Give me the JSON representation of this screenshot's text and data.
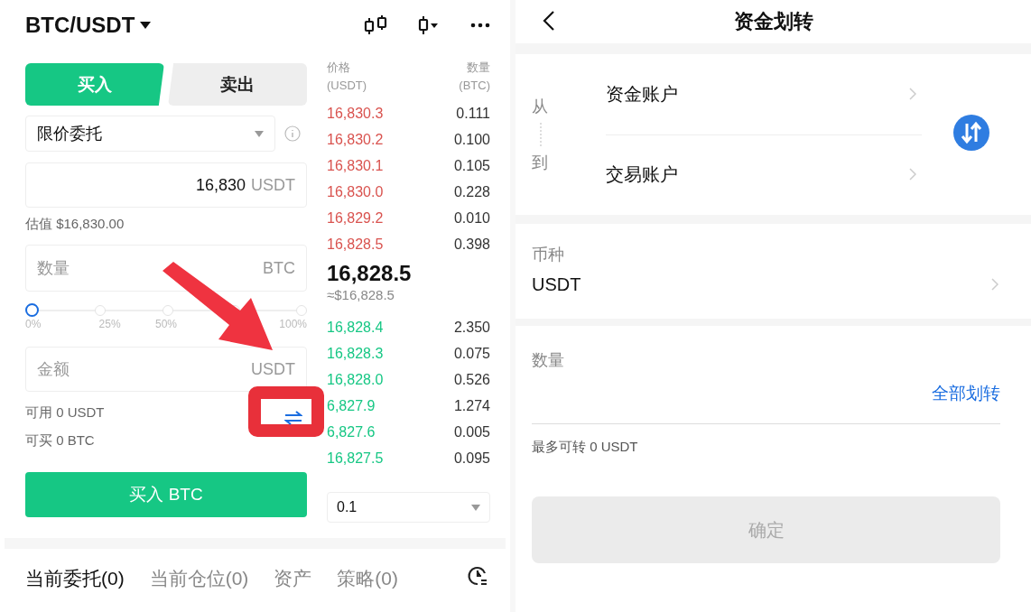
{
  "trade": {
    "pair": "BTC/USDT",
    "side_tabs": [
      {
        "label": "买入",
        "selected": true
      },
      {
        "label": "卖出",
        "selected": false
      }
    ],
    "order_type": "限价委托",
    "price_field": {
      "value": "16,830",
      "unit": "USDT"
    },
    "estimate": "估值 $16,830.00",
    "quantity_field": {
      "placeholder": "数量",
      "unit": "BTC"
    },
    "slider": {
      "level": 0,
      "tick_labels": [
        "0%",
        "25%",
        "50%",
        "100%"
      ]
    },
    "amount_field": {
      "placeholder": "金额",
      "unit": "USDT"
    },
    "available": "可用 0 USDT",
    "buyable": "可买 0 BTC",
    "buy_button": "买入 BTC"
  },
  "order_book": {
    "columns": [
      {
        "label": "价格",
        "unit": "(USDT)"
      },
      {
        "label": "数量",
        "unit": "(BTC)"
      }
    ],
    "asks": [
      {
        "price": "16,830.3",
        "amount": "0.111"
      },
      {
        "price": "16,830.2",
        "amount": "0.100"
      },
      {
        "price": "16,830.1",
        "amount": "0.105"
      },
      {
        "price": "16,830.0",
        "amount": "0.228"
      },
      {
        "price": "16,829.2",
        "amount": "0.010"
      },
      {
        "price": "16,828.5",
        "amount": "0.398"
      }
    ],
    "last_price": "16,828.5",
    "last_price_usd": "≈$16,828.5",
    "bids": [
      {
        "price": "16,828.4",
        "amount": "2.350"
      },
      {
        "price": "16,828.3",
        "amount": "0.075"
      },
      {
        "price": "16,828.0",
        "amount": "0.526"
      },
      {
        "price": "6,827.9",
        "amount": "1.274"
      },
      {
        "price": "6,827.6",
        "amount": "0.005"
      },
      {
        "price": "16,827.5",
        "amount": "0.095"
      }
    ],
    "precision": "0.1"
  },
  "order_tabs": [
    {
      "label": "当前委托(0)",
      "selected": true
    },
    {
      "label": "当前仓位(0)",
      "selected": false
    },
    {
      "label": "资产",
      "selected": false
    },
    {
      "label": "策略(0)",
      "selected": false
    }
  ],
  "transfer": {
    "title": "资金划转",
    "from_label": "从",
    "from_account": "资金账户",
    "to_label": "到",
    "to_account": "交易账户",
    "coin_label": "币种",
    "coin": "USDT",
    "amount_label": "数量",
    "all_button": "全部划转",
    "max": "最多可转 0 USDT",
    "confirm": {
      "label": "确定",
      "disabled": true
    }
  }
}
